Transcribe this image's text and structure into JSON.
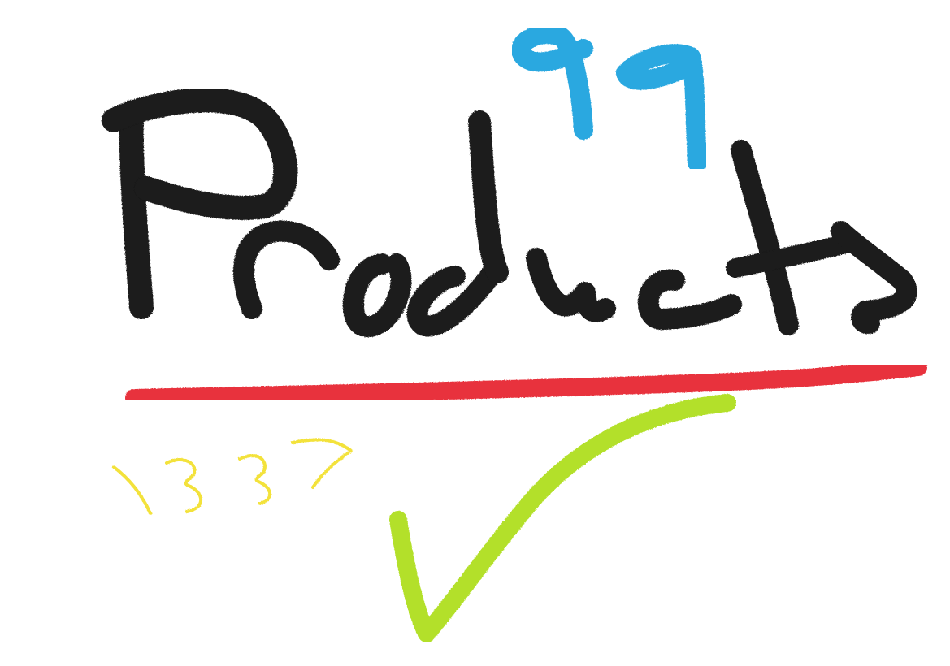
{
  "canvas": {
    "background": "#ffffff"
  },
  "strokes": {
    "word": {
      "text": "Products",
      "color": "#1a1a1a"
    },
    "superscript": {
      "text": "99",
      "color": "#29a8e0"
    },
    "underline": {
      "color": "#e8323c"
    },
    "number": {
      "text": "1337",
      "color": "#f3e23a"
    },
    "checkmark": {
      "icon": "checkmark-icon",
      "color": "#b3e02a"
    }
  }
}
